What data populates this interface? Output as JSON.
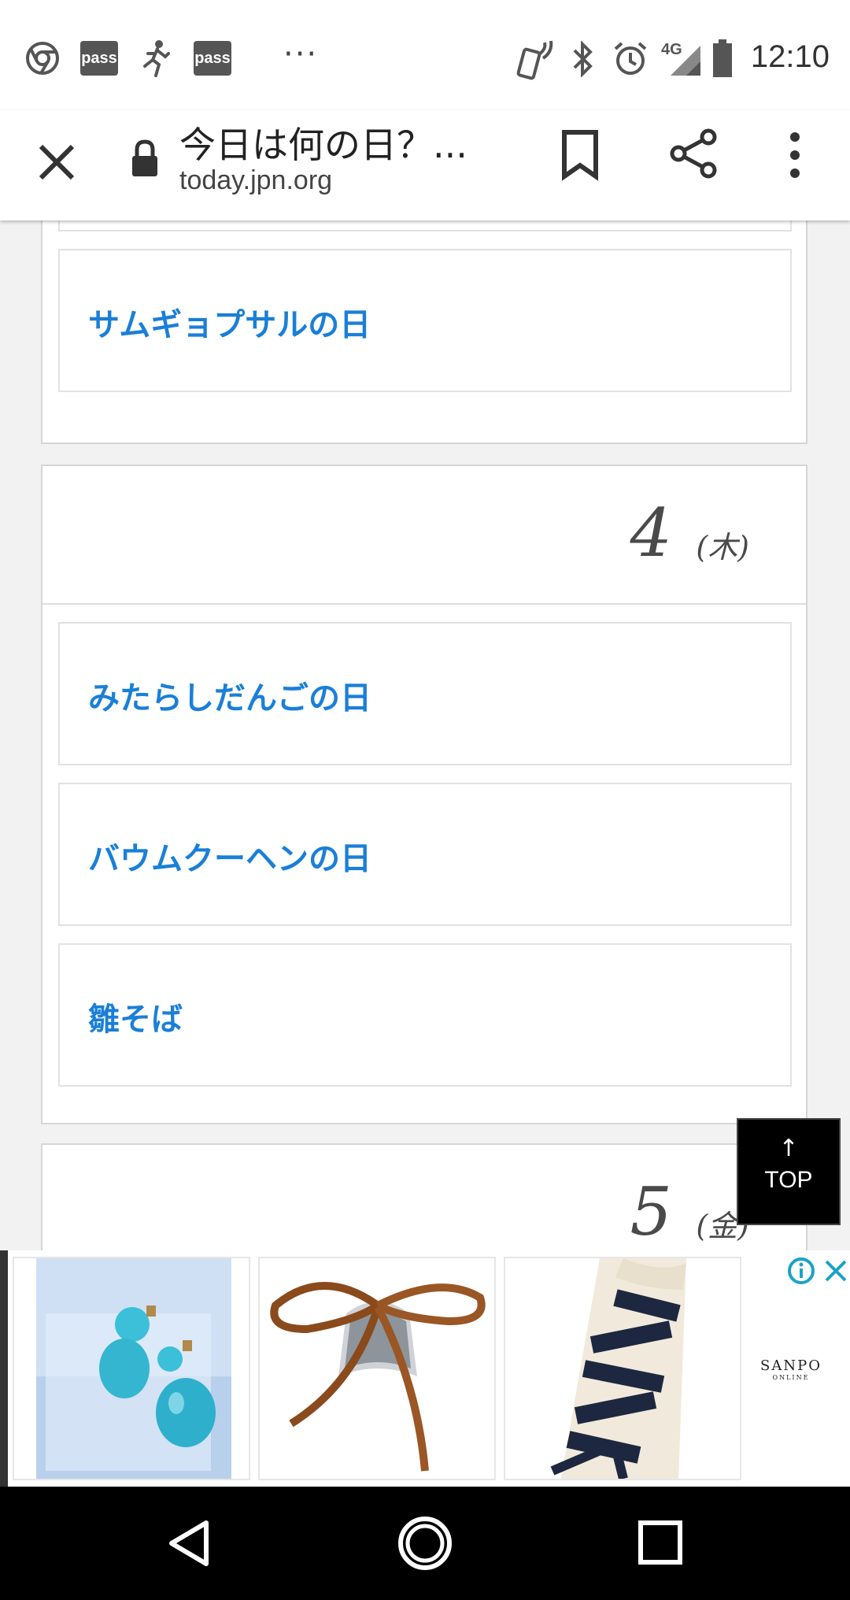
{
  "status_bar": {
    "time": "12:10",
    "pass_badge_1": "pass",
    "pass_badge_2": "pass",
    "overflow": "···",
    "network": "4G",
    "icons": [
      "chrome-icon",
      "pass-icon",
      "running-icon",
      "pass-icon",
      "nfc-phone-icon",
      "bluetooth-icon",
      "alarm-icon",
      "signal-icon",
      "battery-icon"
    ]
  },
  "toolbar": {
    "title": "今日は何の日？...",
    "url": "today.jpn.org",
    "icons": [
      "close-icon",
      "lock-icon",
      "bookmark-icon",
      "share-icon",
      "more-vert-icon"
    ]
  },
  "days": [
    {
      "items": [
        "サムギョプサルの日"
      ]
    },
    {
      "day": "4",
      "weekday": "(木)",
      "items": [
        "みたらしだんごの日",
        "バウムクーヘンの日",
        "雛そば"
      ]
    },
    {
      "day": "5",
      "weekday": "(金)"
    }
  ],
  "top_button": {
    "arrow": "↑",
    "label": "TOP"
  },
  "ad": {
    "brand": "SANPO",
    "brand_sub": "ONLINE",
    "tiles": [
      "earrings-image",
      "bangle-with-ribbon-image",
      "napkin-with-ribbon-image"
    ]
  },
  "nav_bar": {
    "icons": [
      "back-icon",
      "home-icon",
      "recents-icon"
    ]
  },
  "colors": {
    "link": "#1a7fd8",
    "background": "#f2f2f2",
    "card_border": "#d6d6d6"
  }
}
